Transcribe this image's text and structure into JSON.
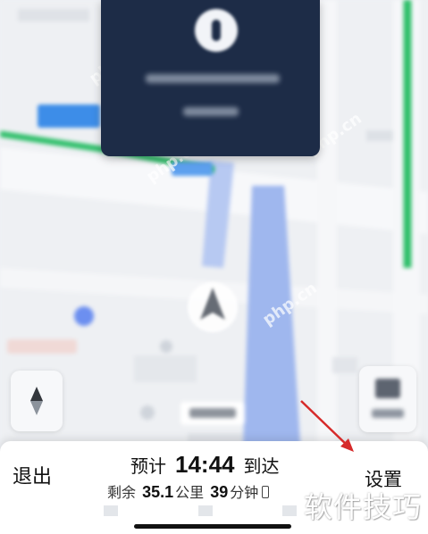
{
  "navigation": {
    "exit_label": "退出",
    "eta_prefix": "预计",
    "eta_time": "14:44",
    "eta_suffix": "到达",
    "remaining_prefix": "剩余",
    "remaining_distance": "35.1",
    "remaining_distance_unit": "公里",
    "remaining_time": "39",
    "remaining_time_unit": "分钟",
    "settings_label": "设置"
  },
  "watermark": {
    "site_text": "php.cn",
    "corner_text": "软件技巧"
  },
  "icons": {
    "turn": "turn-direction-icon",
    "compass": "compass-icon",
    "layers": "map-layers-icon",
    "location": "current-location-arrow-icon",
    "annotation": "red-arrow-icon"
  },
  "colors": {
    "nav_card": "#1d2c47",
    "route_green": "#2fbf6a",
    "route_blue": "#9fb7ee",
    "annotation_red": "#d62a2a"
  }
}
